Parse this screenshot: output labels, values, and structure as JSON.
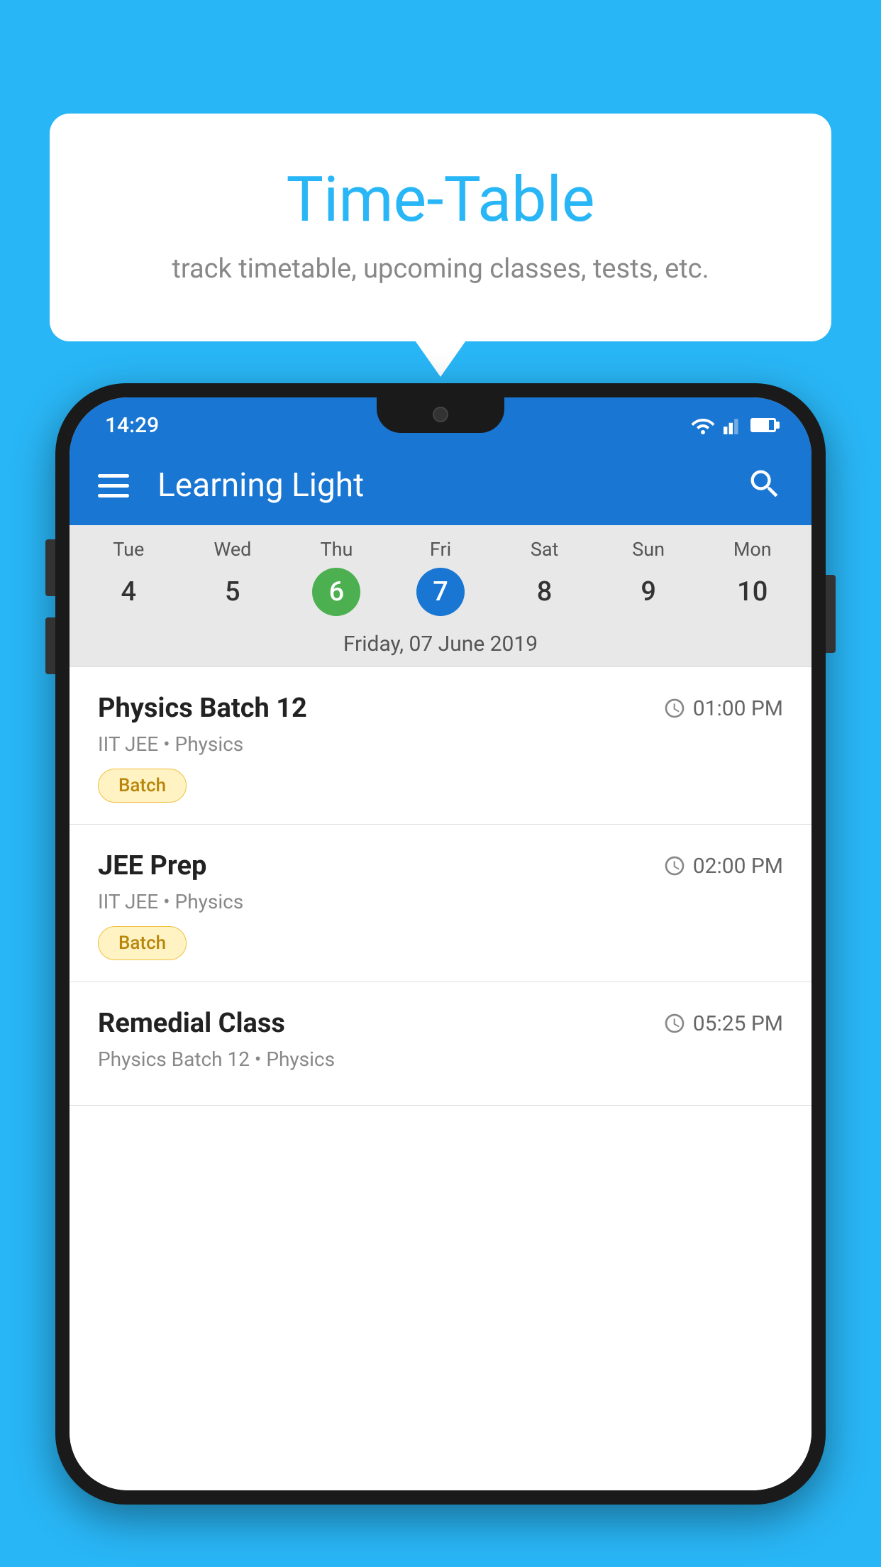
{
  "background_color": "#29B6F6",
  "bubble": {
    "title": "Time-Table",
    "subtitle": "track timetable, upcoming classes, tests, etc."
  },
  "app": {
    "name": "Learning Light",
    "menu_icon": "menu-icon",
    "search_icon": "search-icon"
  },
  "status_bar": {
    "time": "14:29"
  },
  "calendar": {
    "days": [
      {
        "name": "Tue",
        "num": "4",
        "state": "normal"
      },
      {
        "name": "Wed",
        "num": "5",
        "state": "normal"
      },
      {
        "name": "Thu",
        "num": "6",
        "state": "today"
      },
      {
        "name": "Fri",
        "num": "7",
        "state": "selected"
      },
      {
        "name": "Sat",
        "num": "8",
        "state": "normal"
      },
      {
        "name": "Sun",
        "num": "9",
        "state": "normal"
      },
      {
        "name": "Mon",
        "num": "10",
        "state": "normal"
      }
    ],
    "selected_date": "Friday, 07 June 2019"
  },
  "schedule": [
    {
      "title": "Physics Batch 12",
      "time": "01:00 PM",
      "subtitle": "IIT JEE • Physics",
      "badge": "Batch"
    },
    {
      "title": "JEE Prep",
      "time": "02:00 PM",
      "subtitle": "IIT JEE • Physics",
      "badge": "Batch"
    },
    {
      "title": "Remedial Class",
      "time": "05:25 PM",
      "subtitle": "Physics Batch 12 • Physics",
      "badge": null
    }
  ]
}
